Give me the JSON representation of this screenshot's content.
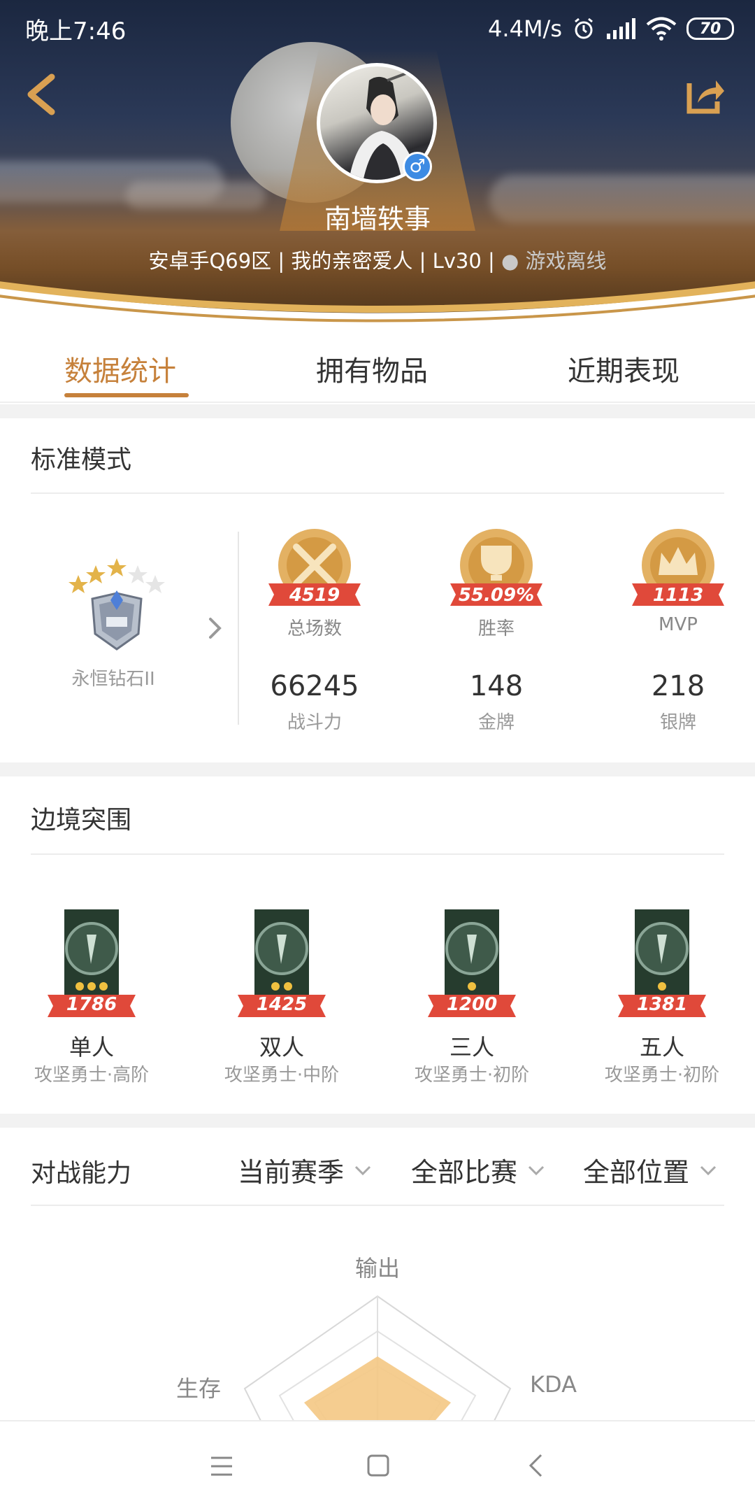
{
  "status_bar": {
    "time": "晚上7:46",
    "speed": "4.4M/s",
    "battery": "70"
  },
  "profile": {
    "nickname": "南墙轶事",
    "gender_symbol": "♂",
    "info": "安卓手Q69区 | 我的亲密爱人 | Lv30 | ",
    "online_status": "● 游戏离线"
  },
  "tabs": [
    {
      "label": "数据统计",
      "active": true
    },
    {
      "label": "拥有物品",
      "active": false
    },
    {
      "label": "近期表现",
      "active": false
    }
  ],
  "standard_mode": {
    "title": "标准模式",
    "rank_name": "永恒钻石II",
    "rank_stars": 5,
    "medals": [
      {
        "value": "4519",
        "label": "总场数",
        "icon": "swords-icon"
      },
      {
        "value": "55.09%",
        "label": "胜率",
        "icon": "trophy-icon"
      },
      {
        "value": "1113",
        "label": "MVP",
        "icon": "crown-icon"
      }
    ],
    "stats": [
      {
        "value": "66245",
        "label": "战斗力"
      },
      {
        "value": "148",
        "label": "金牌"
      },
      {
        "value": "218",
        "label": "银牌"
      }
    ]
  },
  "border_siege": {
    "title": "边境突围",
    "items": [
      {
        "score": "1786",
        "stars": 3,
        "mode": "单人",
        "rank": "攻坚勇士·高阶"
      },
      {
        "score": "1425",
        "stars": 2,
        "mode": "双人",
        "rank": "攻坚勇士·中阶"
      },
      {
        "score": "1200",
        "stars": 1,
        "mode": "三人",
        "rank": "攻坚勇士·初阶"
      },
      {
        "score": "1381",
        "stars": 1,
        "mode": "五人",
        "rank": "攻坚勇士·初阶"
      }
    ]
  },
  "battle_ability": {
    "title": "对战能力",
    "filters": [
      "当前赛季",
      "全部比赛",
      "全部位置"
    ],
    "radar_labels": {
      "top": "输出",
      "left": "生存",
      "right": "KDA"
    }
  },
  "colors": {
    "accent": "#c6813b",
    "medal_ribbon": "#e0493a",
    "gender": "#3d8be3"
  }
}
